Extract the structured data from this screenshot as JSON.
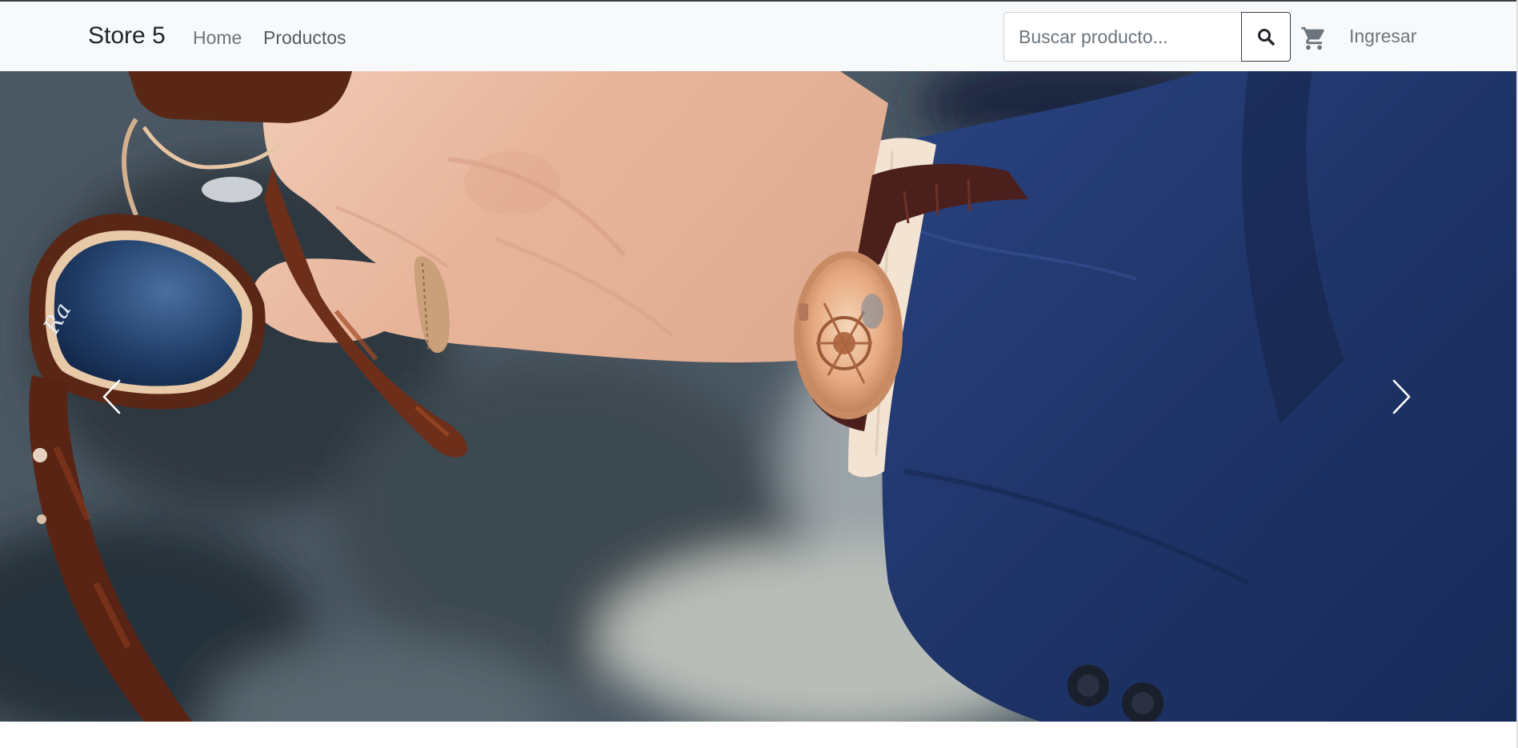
{
  "navbar": {
    "brand": "Store 5",
    "links": [
      {
        "label": "Home"
      },
      {
        "label": "Productos"
      }
    ],
    "search": {
      "placeholder": "Buscar producto...",
      "value": "",
      "button_icon": "search-icon"
    },
    "cart_icon": "cart-icon",
    "login_label": "Ingresar"
  },
  "carousel": {
    "slide_image": "hand-holding-sunglasses-with-wristwatch-and-navy-suit",
    "prev_icon": "chevron-left-icon",
    "next_icon": "chevron-right-icon"
  },
  "colors": {
    "navbar_bg": "#f8f9fa",
    "suit_navy": "#1f3468",
    "skin": "#e8b9a0"
  }
}
